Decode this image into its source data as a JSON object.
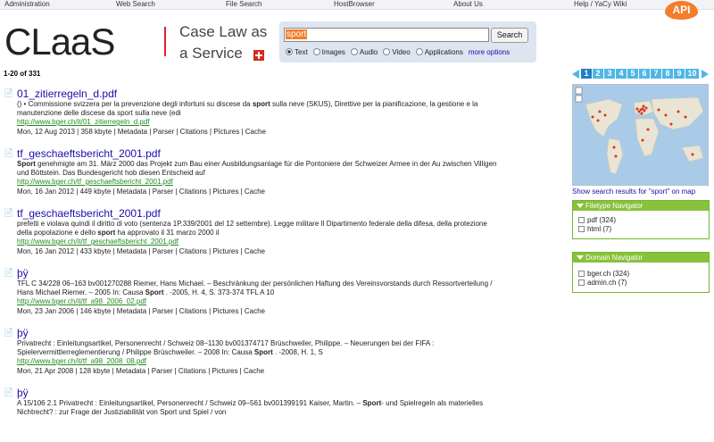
{
  "topnav": {
    "items": [
      "Administration",
      "Web Search",
      "File Search",
      "HostBrowser",
      "About Us",
      "Help / YaCy Wiki"
    ],
    "api_label": "API"
  },
  "header": {
    "logo": "CLaaS",
    "tagline_line1": "Case Law as",
    "tagline_line2": "a Service"
  },
  "search": {
    "query": "sport",
    "button": "Search",
    "options": [
      {
        "label": "Text",
        "selected": true
      },
      {
        "label": "Images",
        "selected": false
      },
      {
        "label": "Audio",
        "selected": false
      },
      {
        "label": "Video",
        "selected": false
      },
      {
        "label": "Applications",
        "selected": false
      }
    ],
    "more_options": "more options"
  },
  "result_count": "1-20 of 331",
  "results": [
    {
      "title": "01_zitierregeln_d.pdf",
      "desc_pre": "() • Commissione svizzera per la prevenzione degli infortuni su discese da ",
      "desc_b": "sport",
      "desc_post": " sulla neve (SKUS), Direttive per la pianificazione, la gestione e la manutenzione delle discese da sport sulla neve (edi",
      "url": "http://www.bger.ch/it/01_zitierregeln_d.pdf",
      "meta": "Mon, 12 Aug 2013  | 358 kbyte  | "
    },
    {
      "title": "tf_geschaeftsbericht_2001.pdf",
      "desc_pre": "",
      "desc_b": "Sport",
      "desc_post": " genehmigte am 31. März 2000 das Projekt zum Bau einer Ausbildungsanlage für die Pontoniere der Schweizer Armee in der Au zwischen Villigen und Böttstein. Das Bundesgericht hob diesen Entscheid auf",
      "url": "http://www.bger.ch/tf_geschaeftsbericht_2001.pdf",
      "meta": "Mon, 16 Jan 2012  | 449 kbyte  | "
    },
    {
      "title": "tf_geschaeftsbericht_2001.pdf",
      "desc_pre": "prefetti e violava quindi il diritto di voto (sentenza 1P.339/2001 del 12 settembre). Legge militare Il Dipartimento federale della difesa, della protezione della popolazione e dello ",
      "desc_b": "sport",
      "desc_post": " ha approvato il 31 marzo 2000 il",
      "url": "http://www.bger.ch/it/tf_geschaeftsbericht_2001.pdf",
      "meta": "Mon, 16 Jan 2012  | 433 kbyte  | "
    },
    {
      "title": "þÿ",
      "desc_pre": "TFL C 34/228 06–163 bv001270288 Riemer, Hans Michael. – Beschränkung der persönlichen Haftung des Vereinsvorstands durch Ressortverteilung / Hans Michael Riemer. – 2005 In: Causa ",
      "desc_b": "Sport",
      "desc_post": " . -2005, H. 4, S. 373-374 TFL A 10",
      "url": "http://www.bger.ch/it/tf_a98_2006_02.pdf",
      "meta": "Mon, 23 Jan 2006  | 146 kbyte  | "
    },
    {
      "title": "þÿ",
      "desc_pre": "Privatrecht : Einleitungsartikel, Personenrecht / Schweiz 08–1130 bv001374717 Brüschweiler, Philippe. – Neuerungen bei der FIFA : Spielervermittlerreglementierung / Philippe Brüschweiler. – 2008 In: Causa ",
      "desc_b": "Sport",
      "desc_post": " . -2008, H. 1, S",
      "url": "http://www.bger.ch/it/tf_a98_2008_08.pdf",
      "meta": "Mon, 21 Apr 2008  | 128 kbyte  | "
    },
    {
      "title": "þÿ",
      "desc_pre": "A 15/106 2.1 Privatrecht : Einleitungsartikel, Personenrecht / Schweiz 09–561 bv001399191 Kaiser, Martin. – ",
      "desc_b": "Sport",
      "desc_post": "- und Spielregeln als materielles Nichtrecht? : zur Frage der Justiziabilität von Sport und Spiel / von",
      "url": "",
      "meta": ""
    }
  ],
  "result_links": [
    "Metadata",
    "Parser",
    "Citations",
    "Pictures",
    "Cache"
  ],
  "pager": [
    "1",
    "2",
    "3",
    "4",
    "5",
    "6",
    "7",
    "8",
    "9",
    "10"
  ],
  "map_link": "Show search results for \"sport\" on map",
  "filetype_nav": {
    "title": "Filetype Navigator",
    "items": [
      "pdf (324)",
      "html (7)"
    ]
  },
  "domain_nav": {
    "title": "Domain Navigator",
    "items": [
      "bger.ch (324)",
      "admin.ch (7)"
    ]
  }
}
